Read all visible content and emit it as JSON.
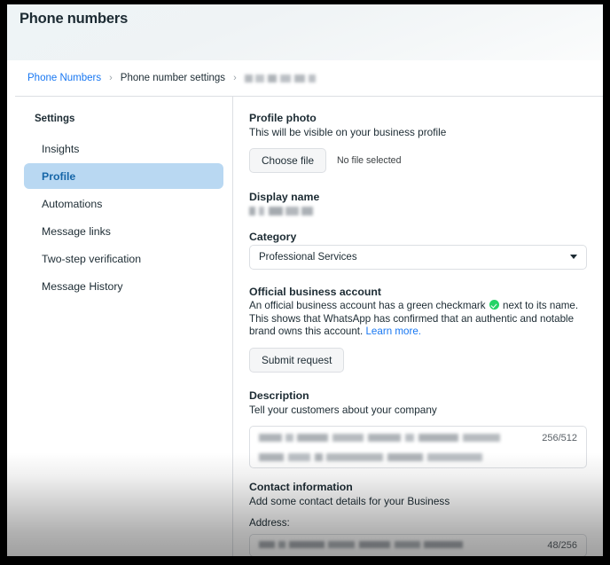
{
  "window": {
    "title": "Phone numbers"
  },
  "breadcrumb": {
    "items": [
      {
        "label": "Phone Numbers",
        "type": "link"
      },
      {
        "label": "Phone number settings",
        "type": "plain"
      },
      {
        "label": "",
        "type": "redacted"
      }
    ],
    "separator": "›"
  },
  "sidebar": {
    "title": "Settings",
    "items": [
      {
        "label": "Insights",
        "active": false
      },
      {
        "label": "Profile",
        "active": true
      },
      {
        "label": "Automations",
        "active": false
      },
      {
        "label": "Message links",
        "active": false
      },
      {
        "label": "Two-step verification",
        "active": false
      },
      {
        "label": "Message History",
        "active": false
      }
    ]
  },
  "main": {
    "profile_photo": {
      "title": "Profile photo",
      "subtitle": "This will be visible on your business profile",
      "choose_file_label": "Choose file",
      "file_status": "No file selected"
    },
    "display_name": {
      "title": "Display name",
      "value": ""
    },
    "category": {
      "title": "Category",
      "selected": "Professional Services",
      "icon": "chevron-down-icon"
    },
    "official_business_account": {
      "title": "Official business account",
      "text_part_1": "An official business account has a green checkmark ",
      "badge_icon": "green-verified-checkmark-icon",
      "text_part_2": " next to its name. This shows that WhatsApp has confirmed that an authentic and notable brand owns this account. ",
      "learn_more_label": "Learn more.",
      "submit_label": "Submit request",
      "badge_color": "#25d366"
    },
    "description": {
      "title": "Description",
      "subtitle": "Tell your customers about your company",
      "counter": "256/512",
      "value": ""
    },
    "contact_information": {
      "title": "Contact information",
      "subtitle": "Add some contact details for your Business",
      "address_label": "Address:",
      "address_counter": "48/256",
      "address_value": ""
    }
  },
  "colors": {
    "accent_link": "#1877f2",
    "active_item_bg": "#b9d8f2",
    "active_item_text": "#1666a8",
    "verified_green": "#25d366",
    "border": "#dcdfe3",
    "text_primary": "#1c2b33"
  }
}
